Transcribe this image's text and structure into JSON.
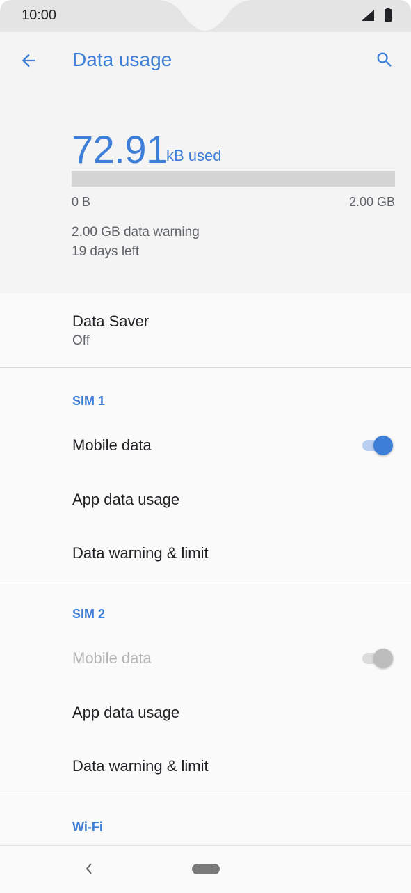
{
  "status": {
    "time": "10:00"
  },
  "header": {
    "title": "Data usage",
    "back_icon": "arrow-back-icon",
    "search_icon": "search-icon"
  },
  "usage": {
    "amount": "72.91",
    "unit": "kB used",
    "bar_fraction": 4e-05,
    "bar_min": "0 B",
    "bar_max": "2.00 GB",
    "warning": "2.00 GB data warning",
    "days_left": "19 days left"
  },
  "data_saver": {
    "title": "Data Saver",
    "status": "Off"
  },
  "sim1": {
    "label": "SIM 1",
    "mobile_data": {
      "label": "Mobile data",
      "on": true
    },
    "app_data_usage": "App data usage",
    "warning_limit": "Data warning & limit"
  },
  "sim2": {
    "label": "SIM 2",
    "mobile_data": {
      "label": "Mobile data",
      "on": true,
      "enabled": false
    },
    "app_data_usage": "App data usage",
    "warning_limit": "Data warning & limit"
  },
  "wifi": {
    "label": "Wi-Fi"
  },
  "colors": {
    "accent": "#3c7ed8"
  }
}
